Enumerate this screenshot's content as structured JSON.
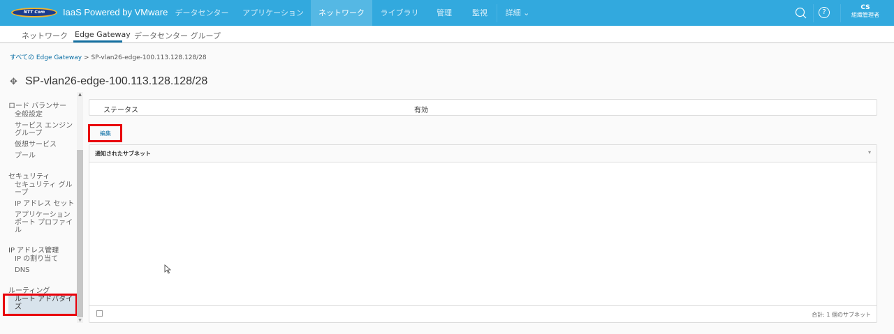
{
  "header": {
    "logo_text": "NTT Communications",
    "app_title": "IaaS Powered by VMware",
    "nav": [
      "データセンター",
      "アプリケーション",
      "ネットワーク",
      "ライブラリ",
      "管理",
      "監視",
      "詳細"
    ],
    "active_nav": "ネットワーク",
    "user": "CS",
    "role": "組織管理者"
  },
  "subnav": {
    "items": [
      "ネットワーク",
      "Edge Gateway",
      "データセンター グループ"
    ],
    "active": "Edge Gateway"
  },
  "breadcrumb": {
    "root": "すべての Edge Gateway",
    "separator": ">",
    "current": "SP-vlan26-edge-100.113.128.128/28"
  },
  "page_title": "SP-vlan26-edge-100.113.128.128/28",
  "sidebar": {
    "groups": [
      {
        "label": "ロード バランサー",
        "items": [
          "全般設定",
          "サービス エンジン グループ",
          "仮想サービス",
          "プール"
        ]
      },
      {
        "label": "セキュリティ",
        "items": [
          "セキュリティ グループ",
          "IP アドレス セット",
          "アプリケーション ポート プロファイル"
        ]
      },
      {
        "label": "IP アドレス管理",
        "items": [
          "IP の割り当て",
          "DNS"
        ]
      },
      {
        "label": "ルーティング",
        "items": [
          "ルート アドバタイズ"
        ]
      }
    ],
    "selected": "ルート アドバタイズ"
  },
  "status": {
    "label": "ステータス",
    "value": "有効"
  },
  "edit_label": "編集",
  "grid": {
    "column": "通知されたサブネット",
    "footer": "合計: 1 個のサブネット"
  },
  "colors": {
    "header": "#32a9de",
    "highlight": "#e8000b"
  }
}
